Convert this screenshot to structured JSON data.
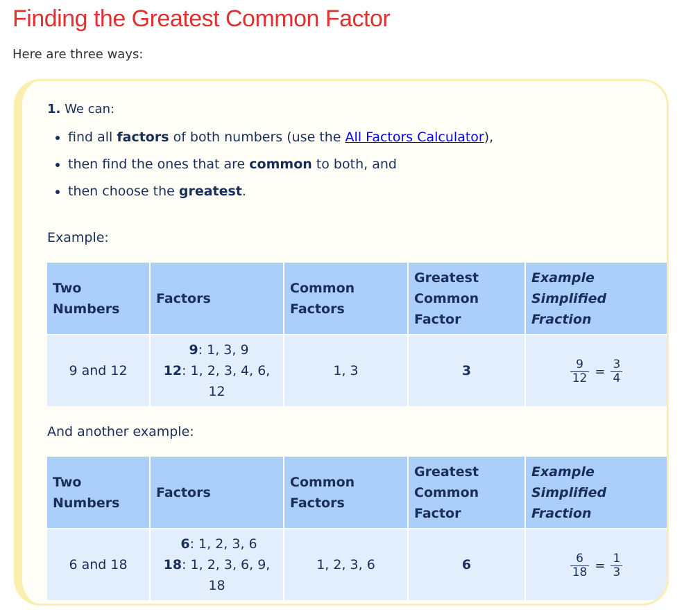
{
  "title": "Finding the Greatest Common Factor",
  "intro": "Here are three ways:",
  "method": {
    "number": "1.",
    "lead": "We can:",
    "steps": [
      {
        "pre": "find all ",
        "bold": "factors",
        "mid": " of both numbers (use the ",
        "link": "All Factors Calculator",
        "post": "),"
      },
      {
        "pre": "then find the ones that are ",
        "bold": "common",
        "post": " to both, and"
      },
      {
        "pre": "then choose the ",
        "bold": "greatest",
        "post": "."
      }
    ]
  },
  "example1_label": "Example:",
  "example2_label": "And another example:",
  "table_headers": {
    "two_numbers": [
      "Two",
      "Numbers"
    ],
    "factors": "Factors",
    "common": [
      "Common",
      "Factors"
    ],
    "gcf": [
      "Greatest",
      "Common",
      "Factor"
    ],
    "fraction": [
      "Example",
      "Simplified",
      "Fraction"
    ]
  },
  "example1": {
    "numbers": "9 and 12",
    "factor_a_label": "9",
    "factor_a_list": ": 1, 3, 9",
    "factor_b_label": "12",
    "factor_b_list": ": 1, 2, 3, 4, 6,",
    "factor_b_wrap": "12",
    "common": "1, 3",
    "gcf": "3",
    "frac_left": {
      "num": "9",
      "den": "12"
    },
    "eq": "=",
    "frac_right": {
      "num": "3",
      "den": "4"
    }
  },
  "example2": {
    "numbers": "6 and 18",
    "factor_a_label": "6",
    "factor_a_list": ": 1, 2, 3, 6",
    "factor_b_label": "18",
    "factor_b_list": ": 1, 2, 3, 6, 9,",
    "factor_b_wrap": "18",
    "common": "1, 2, 3, 6",
    "gcf": "6",
    "frac_left": {
      "num": "6",
      "den": "18"
    },
    "eq": "=",
    "frac_right": {
      "num": "1",
      "den": "3"
    }
  },
  "colors": {
    "title": "#e03030",
    "header_bg": "#abcffa",
    "cell_bg": "#e3eefc",
    "box_border": "#fbefb0",
    "link": "#0000ee"
  }
}
